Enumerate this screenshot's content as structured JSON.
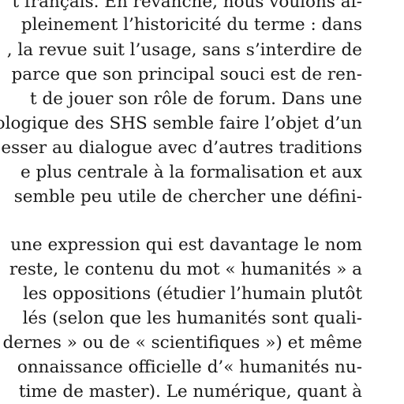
{
  "paragraph_1": [
    "t français. En revanche, nous voulons af-",
    "pleinement l’historicité du terme : dans",
    ", la revue suit l’usage, sans s’interdire de",
    "parce que son principal souci est de ren-",
    "t de jouer son rôle de forum. Dans une",
    "ologique des SHS semble faire l’objet d’un",
    "esser au dialogue avec d’autres traditions",
    "e plus centrale à la formalisation et aux",
    "semble peu utile de chercher une défini-"
  ],
  "paragraph_2": [
    "une expression qui est davantage le nom",
    "reste, le contenu du mot « humanités » a",
    "les oppositions (étudier l’humain plutôt",
    "lés (selon que les humanités sont quali-",
    "dernes » ou de « scientifiques ») et même",
    "onnaissance officielle d’« humanités nu-",
    "time de master). Le numérique, quant à"
  ]
}
